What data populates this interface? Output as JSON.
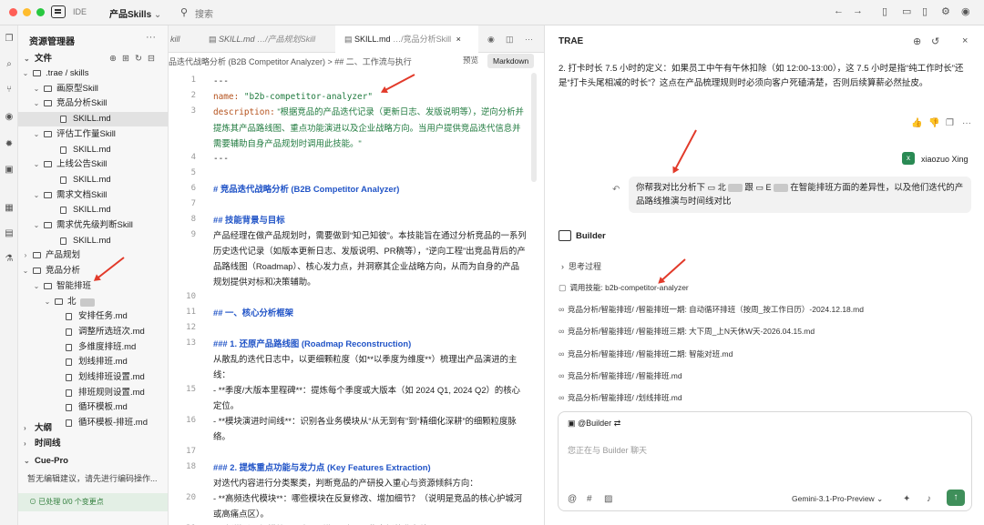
{
  "topbar": {
    "ide_label": "IDE",
    "project": "产品Skills",
    "project_chevron": "chevron-down-icon",
    "search_placeholder": "搜索",
    "traffic_colors": [
      "#ff5f57",
      "#febc2e",
      "#28c840"
    ]
  },
  "sidebar": {
    "title": "资源管理器",
    "files_section": "文件",
    "tree": [
      {
        "label": ".trae / skills",
        "type": "folder",
        "open": true
      },
      {
        "label": "画原型Skill",
        "type": "folder",
        "open": true
      },
      {
        "label": "竞品分析Skill",
        "type": "folder",
        "open": true
      },
      {
        "label": "SKILL.md",
        "type": "file",
        "selected": true
      },
      {
        "label": "评估工作量Skill",
        "type": "folder",
        "open": true
      },
      {
        "label": "SKILL.md",
        "type": "file"
      },
      {
        "label": "上线公告Skill",
        "type": "folder",
        "open": true
      },
      {
        "label": "SKILL.md",
        "type": "file"
      },
      {
        "label": "需求文档Skill",
        "type": "folder",
        "open": true
      },
      {
        "label": "SKILL.md",
        "type": "file"
      },
      {
        "label": "需求优先级判断Skill",
        "type": "folder",
        "open": true
      },
      {
        "label": "SKILL.md",
        "type": "file"
      },
      {
        "label": "产品规划",
        "type": "folder",
        "open": false
      },
      {
        "label": "竞品分析",
        "type": "folder",
        "open": true
      },
      {
        "label": "智能排班",
        "type": "folder",
        "open": true
      },
      {
        "label": "北",
        "type": "folder",
        "open": true
      },
      {
        "label": "安排任务.md",
        "type": "file"
      },
      {
        "label": "调整所选班次.md",
        "type": "file"
      },
      {
        "label": "多维度排班.md",
        "type": "file"
      },
      {
        "label": "划线排班.md",
        "type": "file"
      },
      {
        "label": "划线排班设置.md",
        "type": "file"
      },
      {
        "label": "排班规则设置.md",
        "type": "file"
      },
      {
        "label": "循环模板.md",
        "type": "file"
      },
      {
        "label": "循环模板-排班.md",
        "type": "file"
      }
    ],
    "outline": "大纲",
    "timeline": "时间线",
    "cue_title": "Cue-Pro",
    "cue_desc": "暂无编辑建议，请先进行编码操作...",
    "cue_status": "已处理 0/0 个变更点"
  },
  "editor": {
    "tabs": [
      {
        "name": "kill",
        "path": ""
      },
      {
        "name": "SKILL.md",
        "path": "…/产品规划Skill"
      },
      {
        "name": "SKILL.md",
        "path": "…/竞品分析Skill"
      }
    ],
    "breadcrumb": "品迭代战略分析 (B2B Competitor Analyzer) > ## 二、工作流与执行",
    "preview_label": "预览",
    "mode_label": "Markdown",
    "lines": [
      {
        "n": "1",
        "html": "---"
      },
      {
        "n": "2",
        "key": "name:",
        "val": " \"b2b-competitor-analyzer\""
      },
      {
        "n": "3",
        "key": "description:",
        "val": " \"根据竞品的产品迭代记录（更新日志、发版说明等），逆向分析并提炼其产品路线图、重点功能演进以及企业战略方向。当用户提供竞品迭代信息并需要辅助自身产品规划时调用此技能。\""
      },
      {
        "n": "4",
        "text": "---"
      },
      {
        "n": "5",
        "text": ""
      },
      {
        "n": "6",
        "heading": "# 竞品迭代战略分析 (B2B Competitor Analyzer)"
      },
      {
        "n": "7",
        "text": ""
      },
      {
        "n": "8",
        "heading": "## 技能背景与目标"
      },
      {
        "n": "9",
        "text": "产品经理在做产品规划时，需要做到“知己知彼”。本技能旨在通过分析竞品的一系列历史迭代记录（如版本更新日志、发版说明、PR稿等），“逆向工程”出竞品背后的产品路线图（Roadmap）、核心发力点，并洞察其企业战略方向，从而为自身的产品规划提供对标和决策辅助。"
      },
      {
        "n": "10",
        "text": ""
      },
      {
        "n": "11",
        "heading": "## 一、核心分析框架"
      },
      {
        "n": "12",
        "text": ""
      },
      {
        "n": "13",
        "heading": "### 1. 还原产品路线图 (Roadmap Reconstruction)"
      },
      {
        "n": "",
        "text": "从散乱的迭代日志中，以更细颗粒度（如**以季度为维度**）梳理出产品演进的主线："
      },
      {
        "n": "15",
        "text": "- **季度/大版本里程碑**：提炼每个季度或大版本（如 2024 Q1, 2024 Q2）的核心定位。"
      },
      {
        "n": "16",
        "text": "- **模块演进时间线**：识别各业务模块从“从无到有”到“精细化深耕”的细颗粒度脉络。"
      },
      {
        "n": "17",
        "text": ""
      },
      {
        "n": "18",
        "heading": "### 2. 提炼重点功能与发力点 (Key Features Extraction)"
      },
      {
        "n": "",
        "text": "对迭代内容进行分类聚类，判断竞品的产研投入重心与资源倾斜方向："
      },
      {
        "n": "20",
        "text": "- **高频迭代模块**：哪些模块在反复修改、增加细节？（说明是竞品的核心护城河或高痛点区）。"
      },
      {
        "n": "21",
        "text": "- **新增重量级模块**：竞品近期开辟了哪些全新的业务线？"
      }
    ]
  },
  "chat": {
    "title": "TRAE",
    "prev_answer": "2. 打卡时长 7.5 小时的定义：如果员工中午有午休扣除（如 12:00-13:00），这 7.5 小时是指“纯工作时长”还是“打卡头尾相减的时长”？这点在产品梳理规则时必须向客户死磕清楚，否则后续算薪必然扯皮。",
    "user_name": "xiaozuo Xing",
    "user_initial": "x",
    "user_msg_prefix": "你帮我对比分析下",
    "user_chip1": "北",
    "user_msg_and": "跟",
    "user_chip2": "E",
    "user_msg_suffix": "在智能排班方面的差异性，以及他们迭代的产品路线推演与时间线对比",
    "assistant_name": "Builder",
    "thinking": "思考过程",
    "skill_call": "调用技能: b2b-competitor-analyzer",
    "file_refs": [
      "竞品分析/智能排班/        /智能排班一期: 自动循环排班（按周_按工作日历）-2024.12.18.md",
      "竞品分析/智能排班/        /智能排班三期: 大下周_上N天休W天-2026.04.15.md",
      "竞品分析/智能排班/        /智能排班二期: 智能对班.md",
      "竞品分析/智能排班/      /智能排班.md",
      "竞品分析/智能排班/      /划线排班.md"
    ],
    "input_tag": "@Builder",
    "input_placeholder": "您正在与 Builder 聊天",
    "model": "Gemini-3.1-Pro-Preview",
    "accent": "#3f8f5a",
    "arrow_color": "#e23a2a"
  }
}
